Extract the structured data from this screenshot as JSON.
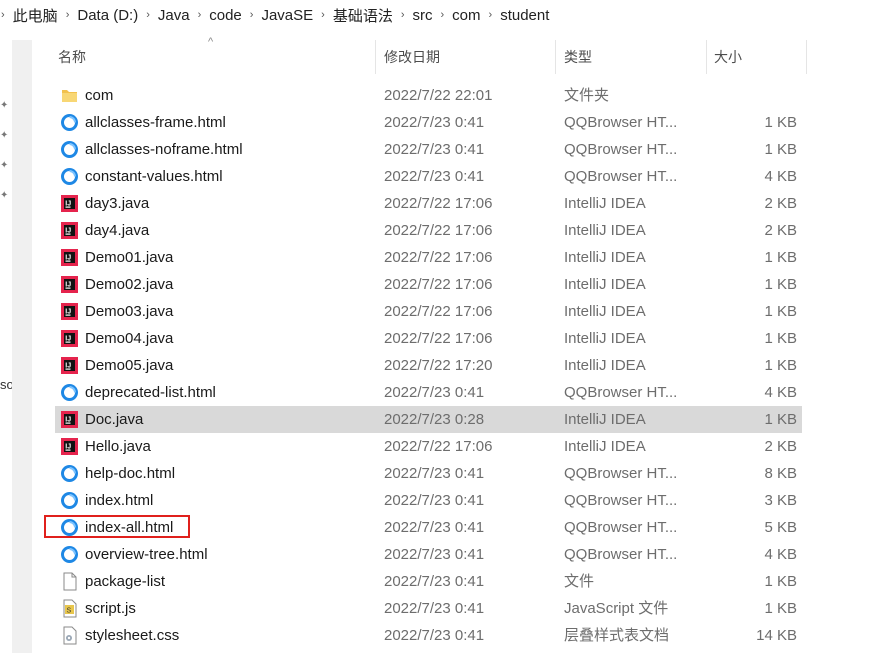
{
  "breadcrumb": [
    "此电脑",
    "Data (D:)",
    "Java",
    "code",
    "JavaSE",
    "基础语法",
    "src",
    "com",
    "student"
  ],
  "nav_cut_text": "so",
  "columns": {
    "name": "名称",
    "date": "修改日期",
    "type": "类型",
    "size": "大小"
  },
  "colors": {
    "selected_row": "#d9d9d9",
    "highlight_box": "#e0201c",
    "folder": "#f2c14e",
    "qq_blue": "#1e88e5",
    "intellij_red": "#e5244d"
  },
  "files": [
    {
      "name": "com",
      "date": "2022/7/22 22:01",
      "type": "文件夹",
      "size": "",
      "icon": "folder-icon"
    },
    {
      "name": "allclasses-frame.html",
      "date": "2022/7/23 0:41",
      "type": "QQBrowser HT...",
      "size": "1 KB",
      "icon": "qqbrowser-icon"
    },
    {
      "name": "allclasses-noframe.html",
      "date": "2022/7/23 0:41",
      "type": "QQBrowser HT...",
      "size": "1 KB",
      "icon": "qqbrowser-icon"
    },
    {
      "name": "constant-values.html",
      "date": "2022/7/23 0:41",
      "type": "QQBrowser HT...",
      "size": "4 KB",
      "icon": "qqbrowser-icon"
    },
    {
      "name": "day3.java",
      "date": "2022/7/22 17:06",
      "type": "IntelliJ IDEA",
      "size": "2 KB",
      "icon": "intellij-icon"
    },
    {
      "name": "day4.java",
      "date": "2022/7/22 17:06",
      "type": "IntelliJ IDEA",
      "size": "2 KB",
      "icon": "intellij-icon"
    },
    {
      "name": "Demo01.java",
      "date": "2022/7/22 17:06",
      "type": "IntelliJ IDEA",
      "size": "1 KB",
      "icon": "intellij-icon"
    },
    {
      "name": "Demo02.java",
      "date": "2022/7/22 17:06",
      "type": "IntelliJ IDEA",
      "size": "1 KB",
      "icon": "intellij-icon"
    },
    {
      "name": "Demo03.java",
      "date": "2022/7/22 17:06",
      "type": "IntelliJ IDEA",
      "size": "1 KB",
      "icon": "intellij-icon"
    },
    {
      "name": "Demo04.java",
      "date": "2022/7/22 17:06",
      "type": "IntelliJ IDEA",
      "size": "1 KB",
      "icon": "intellij-icon"
    },
    {
      "name": "Demo05.java",
      "date": "2022/7/22 17:20",
      "type": "IntelliJ IDEA",
      "size": "1 KB",
      "icon": "intellij-icon"
    },
    {
      "name": "deprecated-list.html",
      "date": "2022/7/23 0:41",
      "type": "QQBrowser HT...",
      "size": "4 KB",
      "icon": "qqbrowser-icon"
    },
    {
      "name": "Doc.java",
      "date": "2022/7/23 0:28",
      "type": "IntelliJ IDEA",
      "size": "1 KB",
      "icon": "intellij-icon",
      "selected": true
    },
    {
      "name": "Hello.java",
      "date": "2022/7/22 17:06",
      "type": "IntelliJ IDEA",
      "size": "2 KB",
      "icon": "intellij-icon"
    },
    {
      "name": "help-doc.html",
      "date": "2022/7/23 0:41",
      "type": "QQBrowser HT...",
      "size": "8 KB",
      "icon": "qqbrowser-icon"
    },
    {
      "name": "index.html",
      "date": "2022/7/23 0:41",
      "type": "QQBrowser HT...",
      "size": "3 KB",
      "icon": "qqbrowser-icon"
    },
    {
      "name": "index-all.html",
      "date": "2022/7/23 0:41",
      "type": "QQBrowser HT...",
      "size": "5 KB",
      "icon": "qqbrowser-icon",
      "highlighted": true
    },
    {
      "name": "overview-tree.html",
      "date": "2022/7/23 0:41",
      "type": "QQBrowser HT...",
      "size": "4 KB",
      "icon": "qqbrowser-icon"
    },
    {
      "name": "package-list",
      "date": "2022/7/23 0:41",
      "type": "文件",
      "size": "1 KB",
      "icon": "blank-file-icon"
    },
    {
      "name": "script.js",
      "date": "2022/7/23 0:41",
      "type": "JavaScript 文件",
      "size": "1 KB",
      "icon": "js-file-icon"
    },
    {
      "name": "stylesheet.css",
      "date": "2022/7/23 0:41",
      "type": "层叠样式表文档",
      "size": "14 KB",
      "icon": "css-file-icon"
    }
  ]
}
